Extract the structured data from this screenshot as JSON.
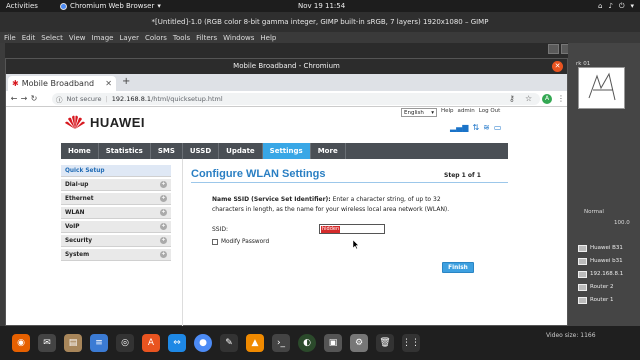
{
  "topbar": {
    "activities": "Activities",
    "app_name": "Chromium Web Browser",
    "clock": "Nov 19  11:54"
  },
  "gimp": {
    "title": "*[Untitled]-1.0 (RGB color 8-bit gamma integer, GIMP built-in sRGB, 7 layers) 1920x1080 – GIMP",
    "menu": [
      "File",
      "Edit",
      "Select",
      "View",
      "Image",
      "Layer",
      "Colors",
      "Tools",
      "Filters",
      "Windows",
      "Help"
    ],
    "image_tab": "rk 01",
    "mode": "Normal",
    "opacity": "100.0",
    "layers": [
      "Huawei B31",
      "Huawei b31",
      "192.168.8.1",
      "Router 2",
      "Router 1"
    ]
  },
  "chromium": {
    "window_title": "Mobile Broadband - Chromium",
    "tab_title": "Mobile Broadband",
    "not_secure": "Not secure",
    "url_host": "192.168.8.1",
    "url_path": "/html/quicksetup.html",
    "avatar_letter": "A"
  },
  "page": {
    "brand": "HUAWEI",
    "language": "English",
    "links": [
      "Help",
      "admin",
      "Log Out"
    ],
    "nav": [
      "Home",
      "Statistics",
      "SMS",
      "USSD",
      "Update",
      "Settings",
      "More"
    ],
    "sidebar": [
      {
        "label": "Quick Setup",
        "active": true,
        "expandable": false
      },
      {
        "label": "Dial-up",
        "active": false,
        "expandable": true
      },
      {
        "label": "Ethernet",
        "active": false,
        "expandable": true
      },
      {
        "label": "WLAN",
        "active": false,
        "expandable": true
      },
      {
        "label": "VoIP",
        "active": false,
        "expandable": true
      },
      {
        "label": "Security",
        "active": false,
        "expandable": true
      },
      {
        "label": "System",
        "active": false,
        "expandable": true
      }
    ],
    "heading": "Configure WLAN Settings",
    "step": "Step 1 of 1",
    "desc_bold": "Name SSID (Service Set Identifier):",
    "desc_rest": " Enter a character string, of up to 32 characters in length, as the name for your wireless local area network (WLAN).",
    "ssid_label": "SSID:",
    "ssid_value": "hidden",
    "modify_password": "Modify Password",
    "finish_button": "Finish",
    "colors": {
      "nav_bg": "#4a4f55",
      "nav_active": "#39a7e6",
      "heading": "#2a7fc3",
      "ssid_highlight": "#d42b2b"
    }
  },
  "dock": {
    "video_size_label": "Video size:",
    "video_size_value": "1166"
  }
}
